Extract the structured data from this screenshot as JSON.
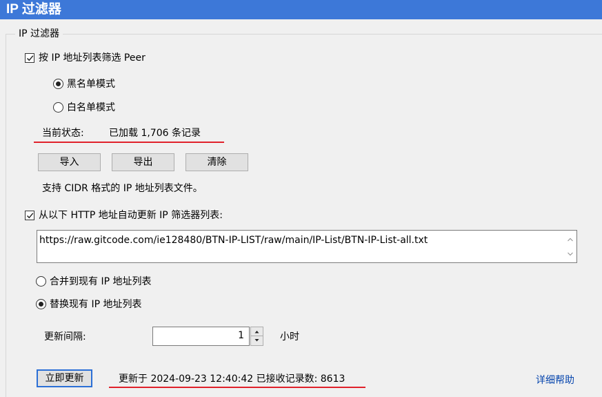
{
  "window": {
    "title": "IP 过滤器"
  },
  "group": {
    "title": "IP 过滤器"
  },
  "filter_checkbox": {
    "label": "按 IP 地址列表筛选 Peer",
    "checked": true
  },
  "mode": {
    "blacklist_label": "黑名单模式",
    "whitelist_label": "白名单模式",
    "selected": "blacklist"
  },
  "status": {
    "label": "当前状态:",
    "value": "已加载 1,706 条记录"
  },
  "buttons": {
    "import": "导入",
    "export": "导出",
    "clear": "清除"
  },
  "hint": "支持 CIDR 格式的 IP 地址列表文件。",
  "auto_update_checkbox": {
    "label": "从以下 HTTP 地址自动更新 IP 筛选器列表:",
    "checked": true
  },
  "url": "https://raw.gitcode.com/ie128480/BTN-IP-LIST/raw/main/IP-List/BTN-IP-List-all.txt",
  "merge_mode": {
    "merge_label": "合并到现有 IP 地址列表",
    "replace_label": "替换现有 IP 地址列表",
    "selected": "replace"
  },
  "interval": {
    "label": "更新间隔:",
    "value": "1",
    "unit": "小时"
  },
  "footer": {
    "update_now": "立即更新",
    "last_update": "更新于 2024-09-23 12:40:42 已接收记录数: 8613",
    "help_link": "详细帮助"
  },
  "colors": {
    "titlebar": "#3d78d8",
    "annotation_underline": "#e0202a",
    "link": "#0645ad"
  }
}
